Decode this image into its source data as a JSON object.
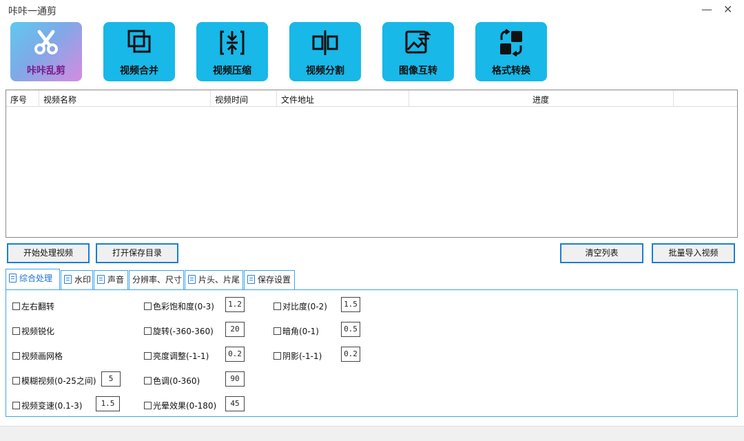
{
  "window": {
    "title": "咔咔一通剪",
    "minimize": "—",
    "close": "✕"
  },
  "toolbar": [
    {
      "label": "咔咔乱剪",
      "icon": "scissors-icon"
    },
    {
      "label": "视频合并",
      "icon": "merge-icon"
    },
    {
      "label": "视频压缩",
      "icon": "compress-icon"
    },
    {
      "label": "视频分割",
      "icon": "split-icon"
    },
    {
      "label": "图像互转",
      "icon": "image-convert-icon"
    },
    {
      "label": "格式转换",
      "icon": "format-convert-icon"
    }
  ],
  "table": {
    "headers": [
      "序号",
      "视频名称",
      "视频时间",
      "文件地址",
      "进度"
    ],
    "rows": []
  },
  "actions": {
    "start": "开始处理视频",
    "open_dir": "打开保存目录",
    "clear": "清空列表",
    "import": "批量导入视频"
  },
  "tabs": [
    "综合处理",
    "水印",
    "声音",
    "分辨率、尺寸",
    "片头、片尾",
    "保存设置"
  ],
  "active_tab": "综合处理",
  "options": {
    "flip_lr": {
      "label": "左右翻转",
      "checked": false
    },
    "sharpen": {
      "label": "视频锐化",
      "checked": false
    },
    "grid": {
      "label": "视频画网格",
      "checked": false
    },
    "blur": {
      "label": "模糊视频(0-25之间)",
      "checked": false,
      "value": "5"
    },
    "speed": {
      "label": "视频变速(0.1-3)",
      "checked": false,
      "value": "1.5"
    },
    "saturation": {
      "label": "色彩饱和度(0-3)",
      "checked": false,
      "value": "1.2"
    },
    "rotate": {
      "label": "旋转(-360-360)",
      "checked": false,
      "value": "20"
    },
    "brightness": {
      "label": "亮度调整(-1-1)",
      "checked": false,
      "value": "0.2"
    },
    "hue": {
      "label": "色调(0-360)",
      "checked": false,
      "value": "90"
    },
    "halo": {
      "label": "光晕效果(0-180)",
      "checked": false,
      "value": "45"
    },
    "contrast": {
      "label": "对比度(0-2)",
      "checked": false,
      "value": "1.5"
    },
    "vignette": {
      "label": "暗角(0-1)",
      "checked": false,
      "value": "0.5"
    },
    "shadow": {
      "label": "阴影(-1-1)",
      "checked": false,
      "value": "0.2"
    }
  },
  "colors": {
    "tool_bg": "#18b8e8",
    "border_blue": "#1a7fd4",
    "tab_border": "#3aa4e8"
  }
}
